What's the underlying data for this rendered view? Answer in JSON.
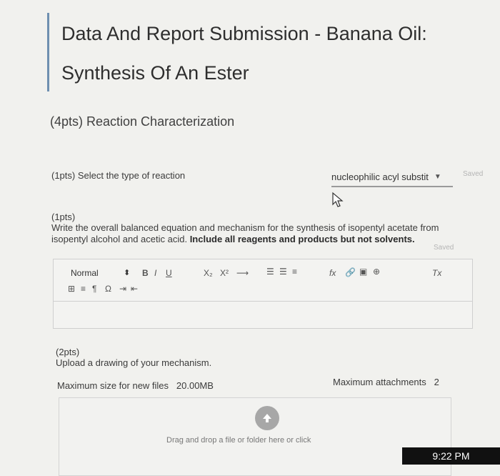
{
  "page": {
    "title_line1": "Data And Report Submission - Banana Oil:",
    "title_line2": "Synthesis Of An Ester",
    "section_heading": "(4pts) Reaction Characterization"
  },
  "q1": {
    "label": "(1pts)  Select the type of reaction",
    "selected_value": "nucleophilic acyl substit",
    "saved": "Saved"
  },
  "q2": {
    "points": "(1pts)",
    "text": "Write the overall balanced equation and mechanism for the synthesis of isopentyl acetate from isopentyl alcohol and acetic acid. ",
    "text_bold": "Include all reagents and products but not solvents.",
    "saved": "Saved"
  },
  "editor": {
    "format_value": "Normal",
    "toolbar": {
      "bold": "B",
      "italic": "I",
      "underline": "U",
      "subscript": "X₂",
      "superscript": "X²",
      "arrow": "⟶",
      "formula": "fx",
      "clear": "Tx"
    }
  },
  "q3": {
    "points": "(2pts)",
    "text": "Upload a drawing of your mechanism.",
    "max_size_label": "Maximum size for new files",
    "max_size_value": "20.00MB",
    "max_attach_label": "Maximum attachments",
    "max_attach_value": "2",
    "drag_text": "Drag and drop a file or folder here or click"
  },
  "taskbar": {
    "time": "9:22 PM"
  },
  "colors": {
    "accent": "#6e8fb0",
    "upload_icon": "#a7a7a7"
  }
}
